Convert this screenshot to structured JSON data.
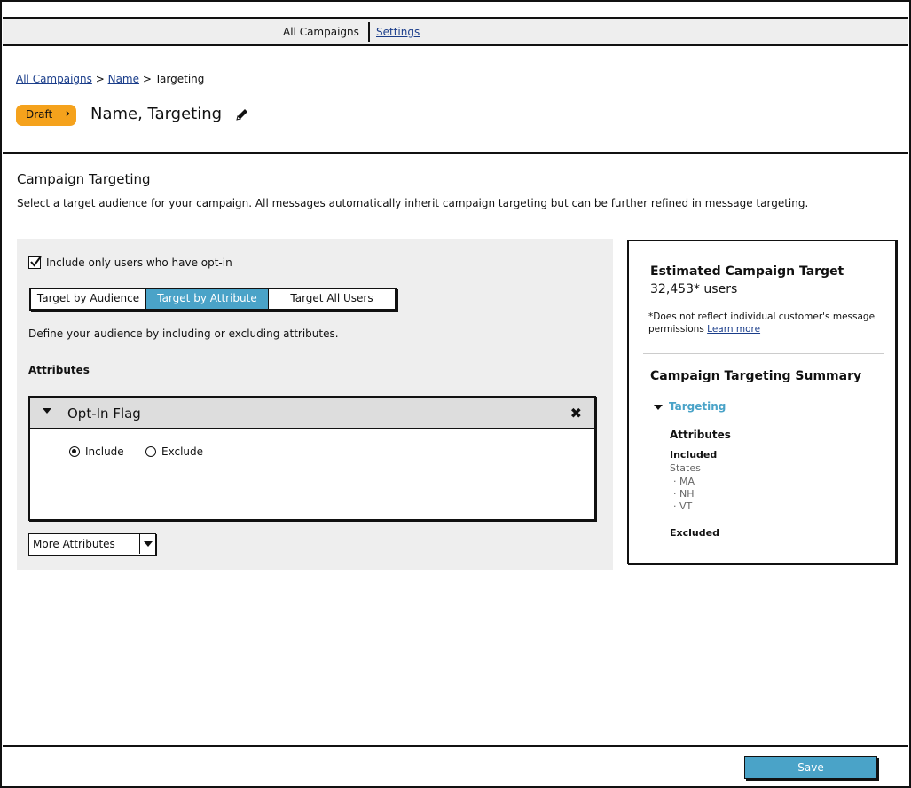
{
  "nav": {
    "all_campaigns": "All Campaigns",
    "settings": "Settings"
  },
  "breadcrumb": {
    "all_campaigns": "All Campaigns",
    "sep1": " > ",
    "name": "Name",
    "sep2": " > ",
    "current": "Targeting"
  },
  "header": {
    "status": "Draft",
    "title": "Name, Targeting"
  },
  "section": {
    "title": "Campaign Targeting",
    "description": "Select a target audience for your campaign. All messages automatically inherit campaign targeting but can be further refined in message targeting."
  },
  "targeting": {
    "optin_label": "Include only users who have opt-in",
    "optin_checked": true,
    "tabs": [
      {
        "label": "Target by Audience",
        "active": false
      },
      {
        "label": "Target by Attribute",
        "active": true
      },
      {
        "label": "Target All Users",
        "active": false
      }
    ],
    "define_text": "Define your audience by including or excluding attributes.",
    "attributes_label": "Attributes",
    "attribute": {
      "title": "Opt-In Flag",
      "include_label": "Include",
      "exclude_label": "Exclude",
      "selected": "Include"
    },
    "more_attributes": "More Attributes"
  },
  "estimate": {
    "title": "Estimated Campaign Target",
    "count": "32,453* users",
    "note": "*Does not reflect individual customer's message permissions ",
    "learn_more": "Learn more"
  },
  "summary": {
    "title": "Campaign Targeting Summary",
    "targeting_label": "Targeting",
    "attributes_label": "Attributes",
    "included_label": "Included",
    "states_label": "States",
    "states": [
      "· MA",
      "· NH",
      "· VT"
    ],
    "excluded_label": "Excluded"
  },
  "footer": {
    "save_label": "Save"
  },
  "colors": {
    "accent": "#4aa3c8",
    "draft": "#f5a21c",
    "link": "#1a3d8a",
    "panel_bg": "#eeeeee"
  },
  "icons": {
    "edit": "pencil-icon",
    "close": "close-icon",
    "expand": "caret-down-icon",
    "check": "checkmark-icon"
  }
}
